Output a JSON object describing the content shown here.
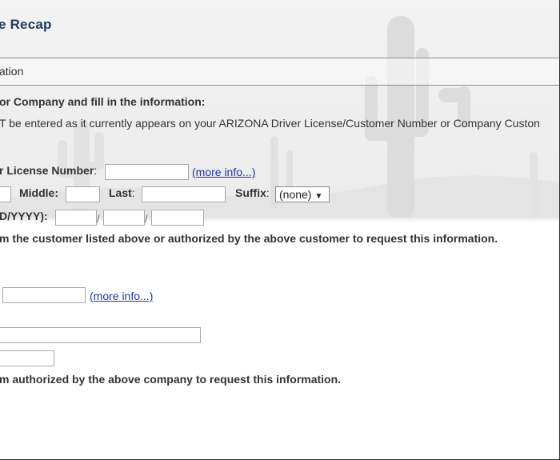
{
  "header": {
    "title": "e Recap"
  },
  "section": {
    "label": "ation"
  },
  "instructions": {
    "select_text": "or Company and fill in the information:",
    "note_text": "T be entered as it currently appears on your ARIZONA Driver License/Customer Number or Company Custon"
  },
  "customer": {
    "license_label": "r License Number",
    "more_info": "(more info...)",
    "middle_label": "Middle:",
    "last_label": "Last",
    "suffix_label": "Suffix",
    "suffix_value": "(none)",
    "dob_label": "D/YYYY):",
    "attest": "m the customer listed above or authorized by the above customer to request this information."
  },
  "company": {
    "more_info": "(more info...)",
    "attest": "m authorized by the above company to request this information."
  },
  "icons": {
    "select_arrow": "chevron-down-icon"
  }
}
